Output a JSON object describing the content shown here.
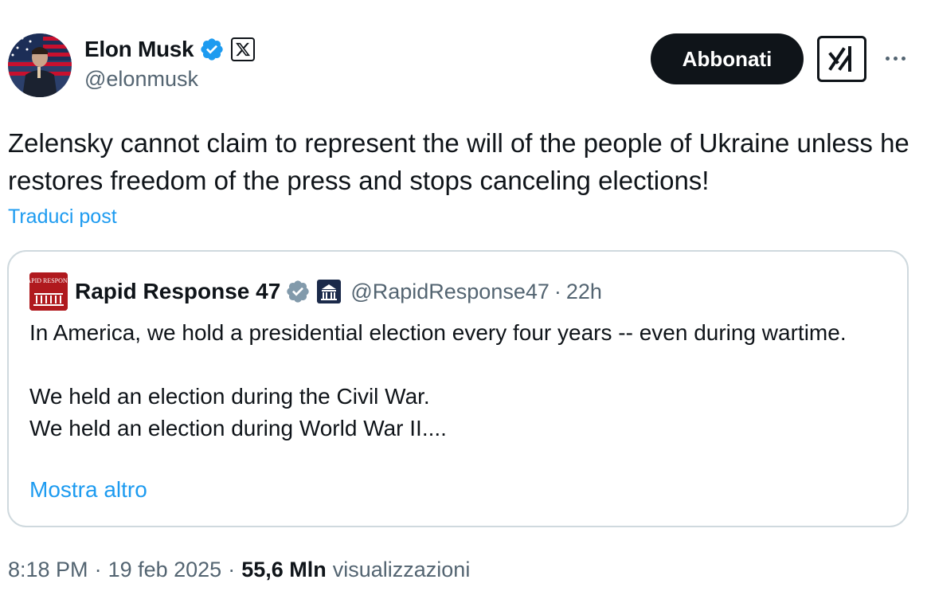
{
  "author": {
    "display_name": "Elon Musk",
    "handle": "@elonmusk"
  },
  "actions": {
    "subscribe_label": "Abbonati"
  },
  "tweet": {
    "text": "Zelensky cannot claim to represent the will of the people of Ukraine unless he restores freedom of the press and stops canceling elections!",
    "translate_label": "Traduci post"
  },
  "quote": {
    "name": "Rapid Response 47",
    "avatar_text": "RAPID RESPONSE",
    "handle": "@RapidResponse47",
    "separator": "·",
    "time": "22h",
    "text": "In America, we hold a presidential election every four years -- even during wartime.\n\nWe held an election during the Civil War.\nWe held an election during World War II....",
    "show_more_label": "Mostra altro"
  },
  "meta": {
    "time": "8:18 PM",
    "separator": "·",
    "date": "19 feb 2025",
    "views_count": "55,6 Mln",
    "views_label": "visualizzazioni"
  },
  "colors": {
    "accent": "#1d9bf0",
    "text": "#0f1419",
    "secondary_text": "#536471",
    "border": "#cfd9de",
    "button_bg": "#0f1419",
    "quote_brand": "#b0191e"
  },
  "icons": {
    "verified": "verified-badge-icon",
    "affiliation": "x-logo-icon",
    "grok": "grok-icon",
    "more": "more-dots-icon"
  }
}
